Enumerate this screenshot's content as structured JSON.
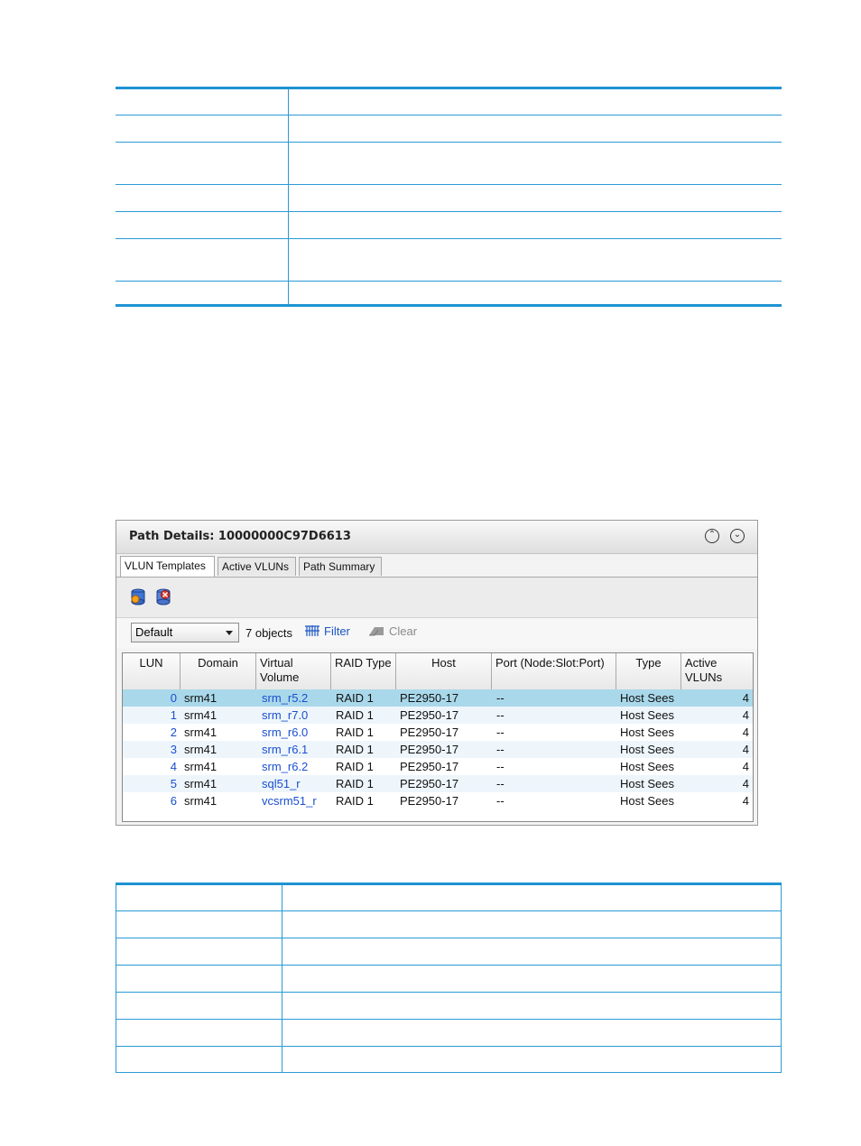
{
  "panel": {
    "title": "Path Details: 10000000C97D6613",
    "tabs": [
      {
        "label": "VLUN Templates",
        "active": true
      },
      {
        "label": "Active VLUNs",
        "active": false
      },
      {
        "label": "Path Summary",
        "active": false
      }
    ],
    "filter": {
      "view_value": "Default",
      "object_count": "7 objects",
      "filter_label": "Filter",
      "clear_label": "Clear"
    },
    "grid": {
      "columns": [
        "LUN",
        "Domain",
        "Virtual Volume",
        "RAID Type",
        "Host",
        "Port (Node:Slot:Port)",
        "Type",
        "Active VLUNs"
      ],
      "rows": [
        {
          "lun": "0",
          "domain": "srm41",
          "volume": "srm_r5.2",
          "raid": "RAID 1",
          "host": "PE2950-17",
          "port": "--",
          "type": "Host Sees",
          "active": "4",
          "selected": true
        },
        {
          "lun": "1",
          "domain": "srm41",
          "volume": "srm_r7.0",
          "raid": "RAID 1",
          "host": "PE2950-17",
          "port": "--",
          "type": "Host Sees",
          "active": "4"
        },
        {
          "lun": "2",
          "domain": "srm41",
          "volume": "srm_r6.0",
          "raid": "RAID 1",
          "host": "PE2950-17",
          "port": "--",
          "type": "Host Sees",
          "active": "4"
        },
        {
          "lun": "3",
          "domain": "srm41",
          "volume": "srm_r6.1",
          "raid": "RAID 1",
          "host": "PE2950-17",
          "port": "--",
          "type": "Host Sees",
          "active": "4"
        },
        {
          "lun": "4",
          "domain": "srm41",
          "volume": "srm_r6.2",
          "raid": "RAID 1",
          "host": "PE2950-17",
          "port": "--",
          "type": "Host Sees",
          "active": "4"
        },
        {
          "lun": "5",
          "domain": "srm41",
          "volume": "sql51_r",
          "raid": "RAID 1",
          "host": "PE2950-17",
          "port": "--",
          "type": "Host Sees",
          "active": "4"
        },
        {
          "lun": "6",
          "domain": "srm41",
          "volume": "vcsrm51_r",
          "raid": "RAID 1",
          "host": "PE2950-17",
          "port": "--",
          "type": "Host Sees",
          "active": "4"
        }
      ]
    }
  },
  "colors": {
    "accent_blue": "#1e93d2",
    "row_selected": "#a9d8ea",
    "row_alt": "#eef6fc",
    "link": "#1a4fd0"
  }
}
